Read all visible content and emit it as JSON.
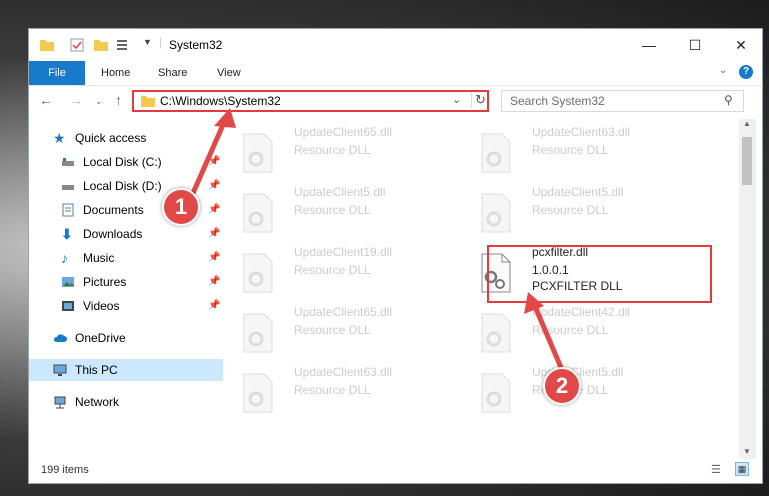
{
  "window": {
    "title": "System32"
  },
  "ribbon": {
    "file": "File",
    "home": "Home",
    "share": "Share",
    "view": "View"
  },
  "address": {
    "path": "C:\\Windows\\System32"
  },
  "search": {
    "placeholder": "Search System32"
  },
  "sidebar": {
    "items": [
      {
        "label": "Quick access"
      },
      {
        "label": "Local Disk (C:)"
      },
      {
        "label": "Local Disk (D:)"
      },
      {
        "label": "Documents"
      },
      {
        "label": "Downloads"
      },
      {
        "label": "Music"
      },
      {
        "label": "Pictures"
      },
      {
        "label": "Videos"
      },
      {
        "label": "OneDrive"
      },
      {
        "label": "This PC"
      },
      {
        "label": "Network"
      }
    ]
  },
  "files": [
    {
      "name": "UpdateClient65.dll",
      "type": "Resource DLL"
    },
    {
      "name": "UpdateClient63.dll",
      "type": "Resource DLL"
    },
    {
      "name": "UpdateClient5.dll",
      "type": "Resource DLL"
    },
    {
      "name": "UpdateClient5.dll",
      "type": "Resource DLL"
    },
    {
      "name": "UpdateClient19.dll",
      "type": "Resource DLL"
    },
    {
      "name": "pcxfilter.dll",
      "version": "1.0.0.1",
      "type": "PCXFILTER DLL"
    },
    {
      "name": "UpdateClient65.dll",
      "type": "Resource DLL"
    },
    {
      "name": "UpdateClient42.dll",
      "type": "Resource DLL"
    },
    {
      "name": "UpdateClient63.dll",
      "type": "Resource DLL"
    },
    {
      "name": "UpdateClient5.dll",
      "type": "Resource DLL"
    }
  ],
  "status": {
    "items": "199 items"
  },
  "annotations": {
    "step1": "1",
    "step2": "2"
  },
  "colors": {
    "accent": "#1979ca",
    "highlight": "#e23b3b",
    "selected": "#cce8ff"
  }
}
